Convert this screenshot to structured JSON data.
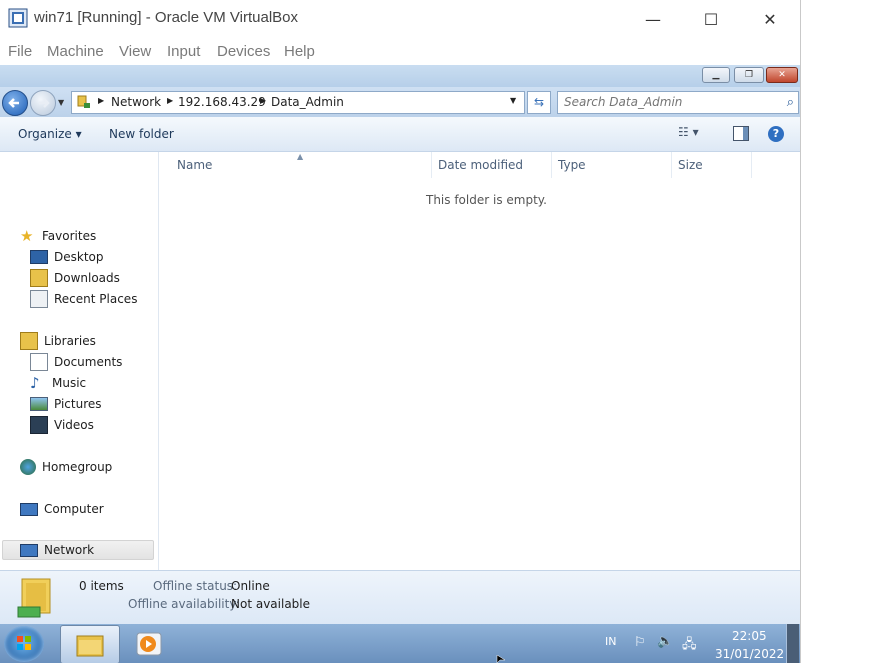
{
  "vbox": {
    "title": "win71 [Running] - Oracle VM VirtualBox",
    "menu": [
      "File",
      "Machine",
      "View",
      "Input",
      "Devices",
      "Help"
    ],
    "window_controls": {
      "minimize": "—",
      "maximize": "☐",
      "close": "✕"
    }
  },
  "explorer": {
    "breadcrumb": [
      "Network",
      "192.168.43.29",
      "Data_Admin"
    ],
    "search_placeholder": "Search Data_Admin",
    "toolbar": {
      "organize": "Organize",
      "new_folder": "New folder",
      "help": "?"
    },
    "nav": {
      "favorites": "Favorites",
      "desktop": "Desktop",
      "downloads": "Downloads",
      "recent": "Recent Places",
      "libraries": "Libraries",
      "documents": "Documents",
      "music": "Music",
      "pictures": "Pictures",
      "videos": "Videos",
      "homegroup": "Homegroup",
      "computer": "Computer",
      "network": "Network"
    },
    "columns": [
      "Name",
      "Date modified",
      "Type",
      "Size"
    ],
    "empty_message": "This folder is empty.",
    "details": {
      "items": "0 items",
      "offline_status_label": "Offline status:",
      "offline_status": "Online",
      "offline_availability_label": "Offline availability:",
      "offline_availability": "Not available"
    }
  },
  "taskbar": {
    "lang": "IN",
    "time": "22:05",
    "date": "31/01/2022"
  },
  "colors": {
    "accent": "#2f6fc1",
    "taskbar": "#7ea3cc"
  }
}
